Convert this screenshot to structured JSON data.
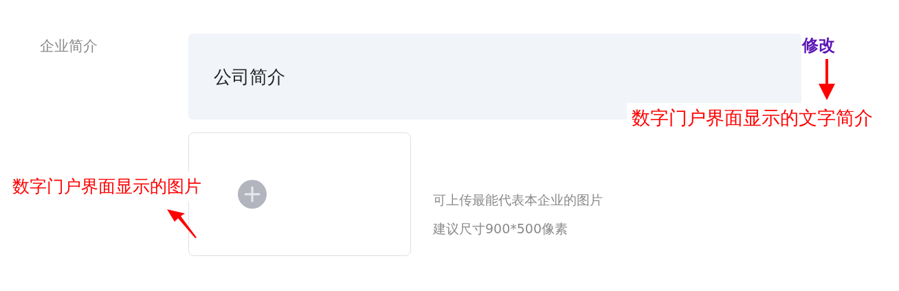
{
  "form": {
    "label": "企业简介",
    "description": {
      "value": "公司简介"
    },
    "upload": {
      "hints": [
        "可上传最能代表本企业的图片",
        "建议尺寸900*500像素"
      ]
    }
  },
  "annotations": [
    {
      "kind": "title",
      "text": "修改"
    },
    {
      "kind": "caption-right",
      "text": "数字门户界面显示的文字简介"
    },
    {
      "kind": "caption-left",
      "text": "数字门户界面显示的图片"
    }
  ]
}
